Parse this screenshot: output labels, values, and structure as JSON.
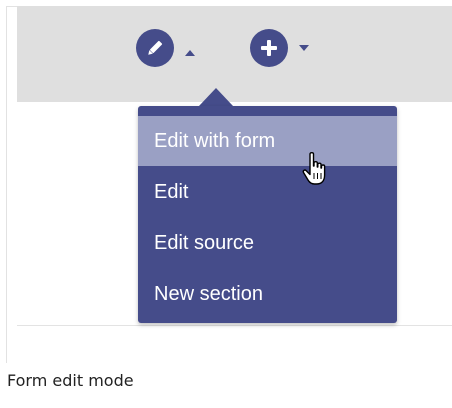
{
  "toolbar": {
    "edit_button": {
      "icon": "pencil-icon",
      "color": "#454c8a"
    },
    "add_button": {
      "icon": "plus-icon",
      "color": "#454c8a"
    },
    "edit_caret": "caret-up-icon",
    "add_caret": "caret-down-icon",
    "background": "#dfdfdf"
  },
  "menu": {
    "background": "#454c8a",
    "highlight": "#9aa0c4",
    "items": [
      {
        "label": "Edit with form",
        "highlighted": true
      },
      {
        "label": "Edit",
        "highlighted": false
      },
      {
        "label": "Edit source",
        "highlighted": false
      },
      {
        "label": "New section",
        "highlighted": false
      }
    ]
  },
  "cursor": {
    "icon": "hand-pointer-icon"
  },
  "caption": "Form edit mode"
}
